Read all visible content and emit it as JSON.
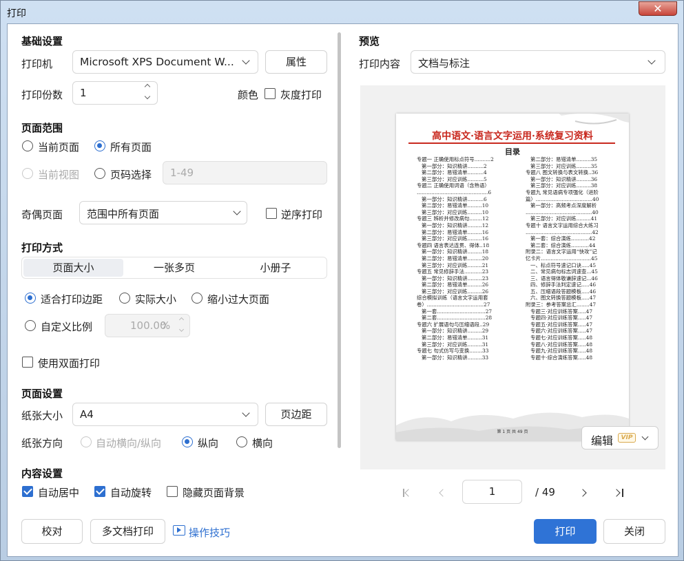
{
  "window": {
    "title": "打印",
    "close_glyph": "✕"
  },
  "basic": {
    "heading": "基础设置",
    "printer_label": "打印机",
    "printer_value": "Microsoft XPS Document W...",
    "properties_button": "属性",
    "copies_label": "打印份数",
    "copies_value": "1",
    "color_label": "颜色",
    "grayscale_label": "灰度打印"
  },
  "range": {
    "heading": "页面范围",
    "current_page": "当前页面",
    "all_pages": "所有页面",
    "current_view": "当前视图",
    "page_select": "页码选择",
    "page_select_placeholder": "1-49",
    "odd_even_label": "奇偶页面",
    "odd_even_value": "范围中所有页面",
    "reverse_label": "逆序打印"
  },
  "mode": {
    "heading": "打印方式",
    "tabs": [
      "页面大小",
      "一张多页",
      "小册子"
    ],
    "fit_margin": "适合打印边距",
    "actual_size": "实际大小",
    "shrink_large": "缩小过大页面",
    "custom_scale": "自定义比例",
    "custom_scale_value": "100.00",
    "custom_scale_unit": "%",
    "duplex": "使用双面打印"
  },
  "page_setup": {
    "heading": "页面设置",
    "paper_size_label": "纸张大小",
    "paper_size_value": "A4",
    "margins_button": "页边距",
    "orientation_label": "纸张方向",
    "auto_orientation": "自动横向/纵向",
    "portrait": "纵向",
    "landscape": "横向"
  },
  "content": {
    "heading": "内容设置",
    "auto_center": "自动居中",
    "auto_rotate": "自动旋转",
    "hide_background": "隐藏页面背景"
  },
  "footer": {
    "proof_button": "校对",
    "multi_doc_button": "多文档打印",
    "tips_link": "操作技巧",
    "print_button": "打印",
    "close_button": "关闭"
  },
  "preview": {
    "heading": "预览",
    "content_label": "打印内容",
    "content_value": "文档与标注",
    "edit_button": "编辑",
    "vip_badge": "VIP",
    "current_page": "1",
    "total_pages": "/ 49",
    "doc": {
      "title": "高中语文·语言文字运用·系统复习资料",
      "toc_heading": "目录",
      "left_column": "专题一 正确使用标点符号..........2\n   第一部分：知识精讲..........2\n   第二部分：易错清单..........4\n   第三部分：对应训练..........5\n专题二 正确使用词语（含熟语）\n............................................6\n   第一部分：知识精讲..........6\n   第二部分：易错清单.........10\n   第三部分：对应训练.........10\n专题三 辨析并修改病句........12\n   第一部分：知识精讲.........12\n   第二部分：易错清单.........16\n   第三部分：对应训练.........16\n专题四 语言表达连贯、得体..18\n   第一部分：知识精讲.........18\n   第二部分：易错清单.........20\n   第三部分：对应训练.........21\n专题五 常见修辞手法...........23\n   第一部分：知识精讲.........23\n   第二部分：易错清单.........26\n   第三部分：对应训练.........26\n综合模拟训练（语言文字运用套\n卷）...................................27\n   第一套..............................27\n   第二套..............................28\n专题六 扩展语句与压缩语段..29\n   第一部分：知识精讲.........29\n   第二部分：易错清单.........31\n   第三部分：对应训练.........31\n专题七 句式仿写与变换........33\n   第一部分：知识精讲.........33",
      "right_column": "   第二部分：易错清单.........35\n   第三部分：对应训练.........35\n专题八 图文转换与表文转换..36\n   第一部分：知识精讲.........36\n   第三部分：对应训练.........38\n专题九 常见语病专项强化（进阶\n篇）...................................40\n   第一部分：高频考点深度解析\n.........................................40\n   第三部分：对应训练.........41\n专题十 语言文字运用综合大练习\n.........................................42\n   第一套：综合演练...........42\n   第二套：综合演练...........44\n附录二：语言文字运用“快攻”记\n忆卡片...............................45\n   一、标点符号速记口诀.....45\n   二、常见病句标志词速查...45\n   三、语言得体敬谦辞速记...46\n   四、修辞手法判定速记.....46\n   五、压缩语段答题模板.....46\n   六、图文转换答题模板.....47\n附录三：参考答案总汇........47\n   专题三·对应训练答案.....47\n   专题四·对应训练答案.....47\n   专题五·对应训练答案.....47\n   专题六·对应训练答案.....47\n   专题七·对应训练答案.....48\n   专题八·对应训练答案.....48\n   专题九·对应训练答案.....48\n   专题十·综合演练答案.....48",
      "footer": "第 1 页 共 49 页"
    }
  }
}
